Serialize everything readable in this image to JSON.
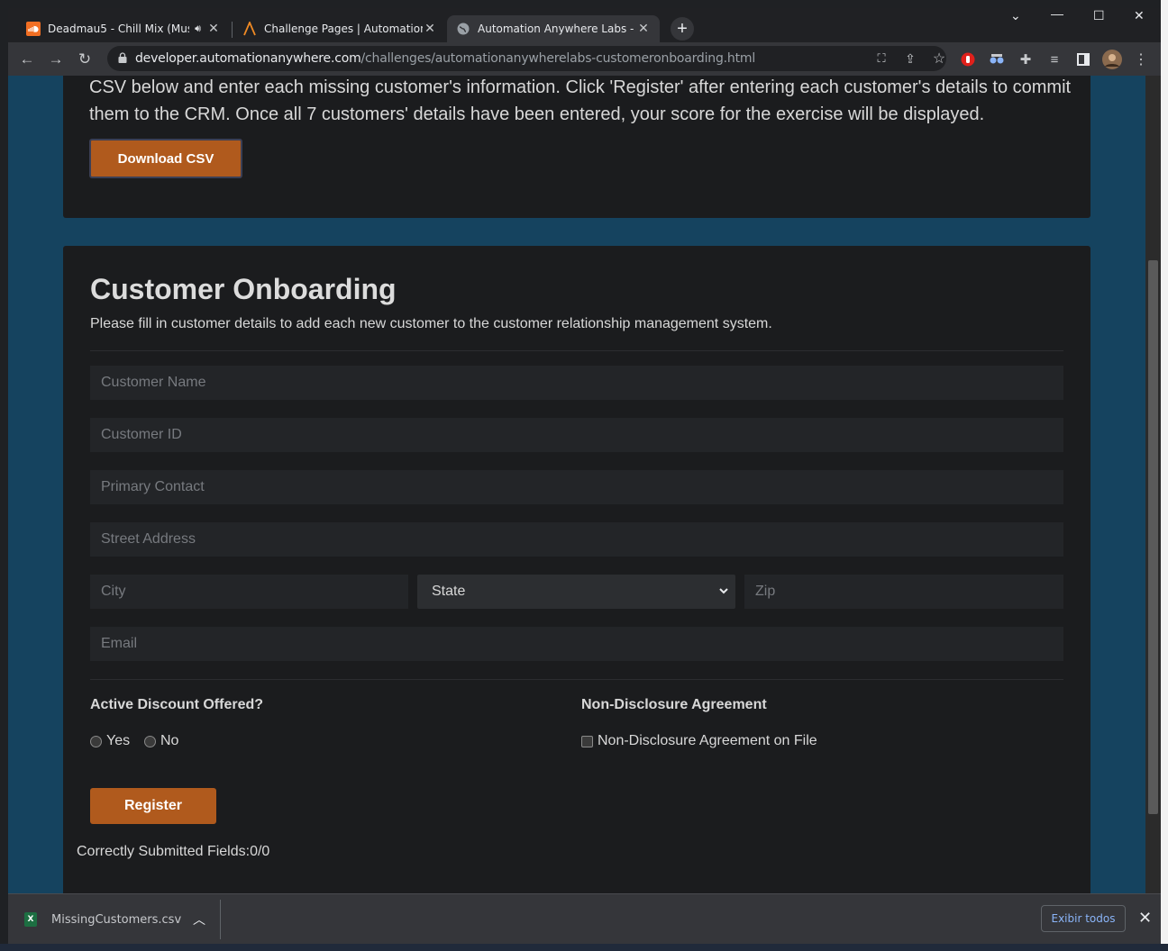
{
  "browser": {
    "tabs": [
      {
        "title": "Deadmau5 - Chill Mix (Music",
        "favicon": "soundcloud-icon",
        "audio": true
      },
      {
        "title": "Challenge Pages | Automation Ar",
        "favicon": "automation-anywhere-logo-icon"
      },
      {
        "title": "Automation Anywhere Labs - Cus",
        "favicon": "globe-icon",
        "active": true
      }
    ],
    "url_host": "developer.automationanywhere.com",
    "url_path": "/challenges/automationanywherelabs-customeronboarding.html"
  },
  "intro": {
    "text": "CSV below and enter each missing customer's information. Click 'Register' after entering each customer's details to commit them to the CRM. Once all 7 customers' details have been entered, your score for the exercise will be displayed.",
    "download_label": "Download CSV"
  },
  "form": {
    "title": "Customer Onboarding",
    "subtitle": "Please fill in customer details to add each new customer to the customer relationship management system.",
    "placeholders": {
      "name": "Customer Name",
      "id": "Customer ID",
      "contact": "Primary Contact",
      "street": "Street Address",
      "city": "City",
      "zip": "Zip",
      "email": "Email"
    },
    "state_selected": "State",
    "discount_label": "Active Discount Offered?",
    "discount_yes": "Yes",
    "discount_no": "No",
    "nda_label": "Non-Disclosure Agreement",
    "nda_option": "Non-Disclosure Agreement on File",
    "register_label": "Register",
    "status": "Correctly Submitted Fields:0/0"
  },
  "downloads": {
    "file": "MissingCustomers.csv",
    "show_all": "Exibir todos"
  },
  "colors": {
    "accent": "#b05a1d",
    "page_bg": "#15435f",
    "card_bg": "#1b1c1e"
  }
}
